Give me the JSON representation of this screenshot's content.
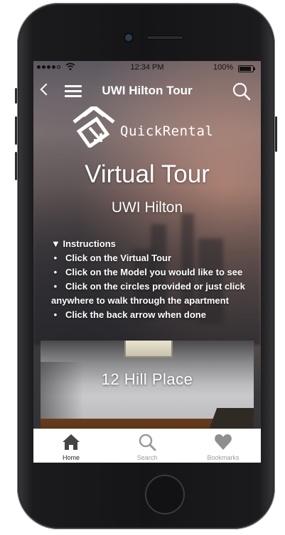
{
  "status_bar": {
    "time": "12:34 PM",
    "battery_percent": "100%",
    "signal_icon": "signal-dots-icon",
    "wifi_icon": "wifi-icon"
  },
  "nav_bar": {
    "title": "UWI Hilton Tour",
    "back_icon": "chevron-left-icon",
    "menu_icon": "hamburger-menu-icon",
    "search_icon": "search-icon"
  },
  "logo": {
    "text": "QuickRental"
  },
  "page": {
    "title": "Virtual Tour",
    "subtitle": "UWI Hilton"
  },
  "instructions": {
    "toggle": "▼ Instructions",
    "items": [
      "Click on the Virtual Tour",
      "Click on the Model you would like to see",
      "Click on the circles provided or just click",
      "anywhere to walk through the apartment",
      "Click the back arrow when done"
    ]
  },
  "property_card": {
    "name": "12 Hill Place"
  },
  "tab_bar": {
    "tabs": [
      {
        "label": "Home",
        "icon": "home-icon",
        "active": true
      },
      {
        "label": "Search",
        "icon": "search-icon",
        "active": false
      },
      {
        "label": "Bookmarks",
        "icon": "heart-icon",
        "active": false
      }
    ]
  },
  "colors": {
    "text_on_image": "#ffffff",
    "tab_bar_background": "#ffffff",
    "tab_inactive": "#9a9a9a",
    "tab_active": "#222222"
  }
}
